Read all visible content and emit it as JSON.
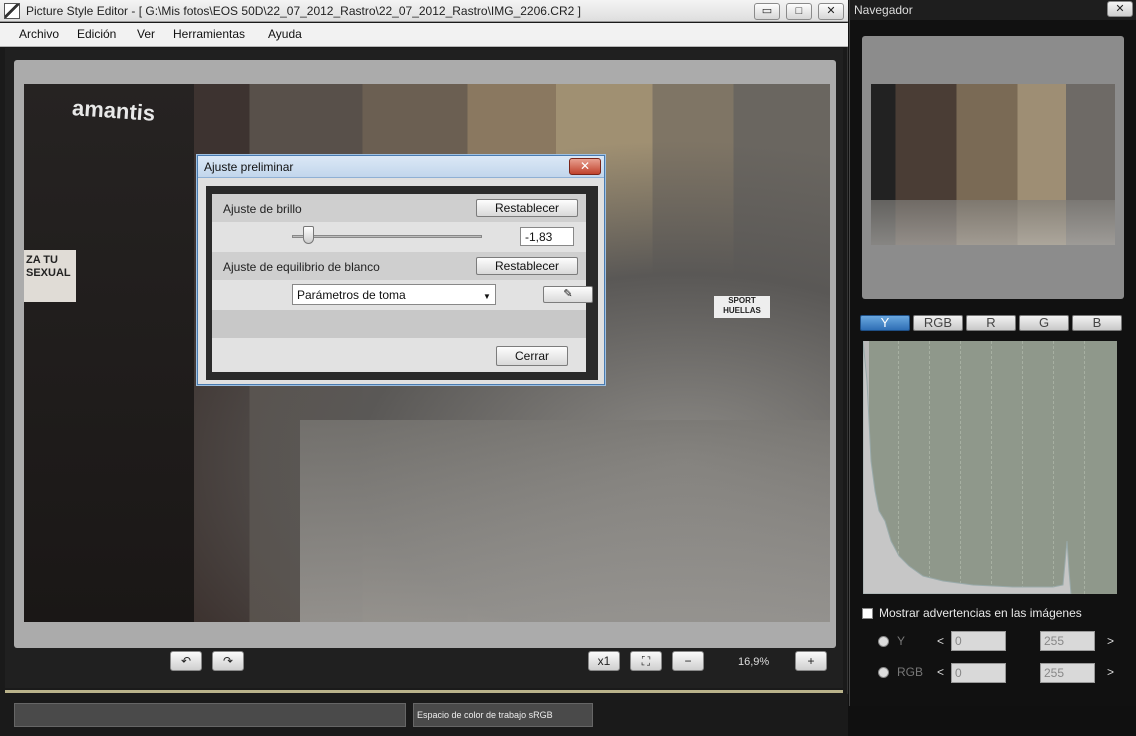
{
  "window": {
    "title": "Picture Style Editor - [ G:\\Mis fotos\\EOS 50D\\22_07_2012_Rastro\\22_07_2012_Rastro\\IMG_2206.CR2 ]",
    "minimize": "▭",
    "maximize": "□",
    "close": "✕"
  },
  "menu": [
    "Archivo",
    "Edición",
    "Ver",
    "Herramientas",
    "Ayuda"
  ],
  "photo": {
    "logo_text": "amantis",
    "sign_text": "ZA TU SEXUAL",
    "sport_text": "SPORT HUELLAS"
  },
  "toolbar": {
    "rotate_left": "↶",
    "rotate_right": "↷",
    "zoom_1x": "x1",
    "fit": "⛶",
    "zoom_out": "−",
    "zoom_level": "16,9%",
    "zoom_in": "+"
  },
  "status": {
    "left": "",
    "color_space": "Espacio de color de trabajo sRGB"
  },
  "dialog": {
    "title": "Ajuste preliminar",
    "close": "✕",
    "brightness_label": "Ajuste de brillo",
    "brightness_reset": "Restablecer",
    "brightness_value": "-1,83",
    "brightness_level": 0.06,
    "wb_label": "Ajuste de equilibrio de blanco",
    "wb_reset": "Restablecer",
    "wb_selected": "Parámetros de toma",
    "close_button": "Cerrar"
  },
  "navigator": {
    "title": "Navegador",
    "close": "✕",
    "channel_tabs": [
      "Y",
      "RGB",
      "R",
      "G",
      "B"
    ],
    "active_tab": "Y",
    "show_warnings_label": "Mostrar advertencias en las imágenes",
    "warnings_checked": false,
    "y_label": "Y",
    "rgb_label": "RGB",
    "lt": "<",
    "gt": ">",
    "y_min": "0",
    "y_max": "255",
    "rgb_min": "0",
    "rgb_max": "255"
  }
}
